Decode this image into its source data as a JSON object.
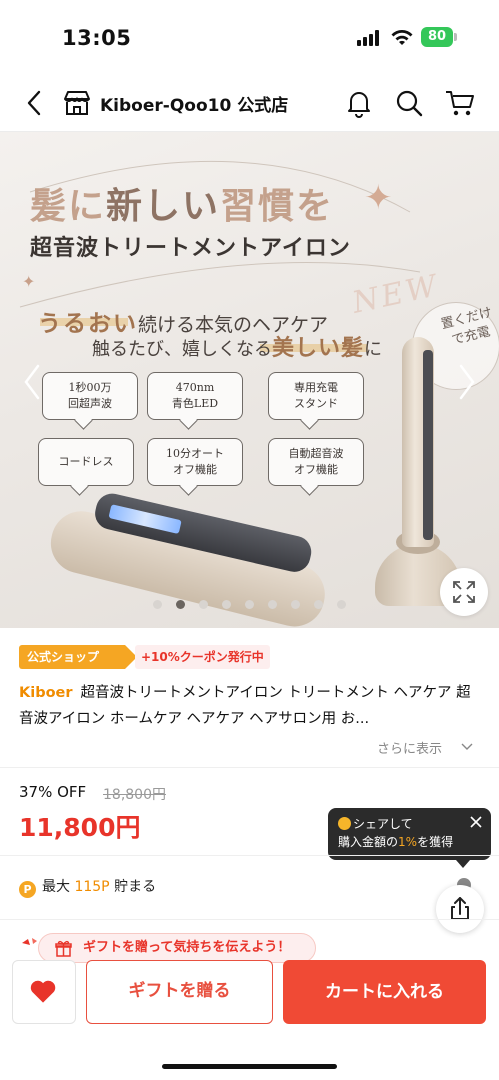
{
  "status_bar": {
    "time": "13:05",
    "battery": "80"
  },
  "header": {
    "title": "Kiboer-Qoo10 公式店"
  },
  "hero": {
    "headline_a": "髪に",
    "headline_b": "新しい",
    "headline_c": "習慣を",
    "subtitle": "超音波トリートメントアイロン",
    "tag_new": "NEW",
    "line1_hl": "うるおい",
    "line1_rest": "続ける本気のヘアケア",
    "line2_start": "触るたび、嬉しくなる",
    "line2_hl": "美しい髪",
    "line2_end": "に",
    "stamp": "置くだけで充電",
    "features": [
      {
        "l1": "1秒00万",
        "l2": "回超声波"
      },
      {
        "l1": "470nm",
        "l2": "青色LED"
      },
      {
        "l1": "専用充電",
        "l2": "スタンド"
      },
      {
        "l1": "コードレス",
        "l2": ""
      },
      {
        "l1": "10分オート",
        "l2": "オフ機能"
      },
      {
        "l1": "自動超音波",
        "l2": "オフ機能"
      }
    ],
    "carousel": {
      "total": 9,
      "active": 2
    }
  },
  "badges": {
    "official": "公式ショップ",
    "coupon": "+10%クーポン発行中"
  },
  "product": {
    "brand": "Kiboer",
    "title": "超音波トリートメントアイロン トリートメント ヘアケア 超音波アイロン ホームケア ヘアケア ヘアサロン用 お...",
    "more": "さらに表示"
  },
  "price": {
    "discount": "37% OFF",
    "original": "18,800円",
    "current": "11,800円"
  },
  "share_tip": {
    "line1": "シェアして",
    "line2_a": "購入金額の",
    "line2_pct": "1%",
    "line2_b": "を獲得"
  },
  "points": {
    "prefix": "最大",
    "amount": "115P",
    "suffix": "貯まる"
  },
  "gift_banner": "ギフトを贈って気持ちを伝えよう！",
  "actions": {
    "gift": "ギフトを贈る",
    "cart": "カートに入れる"
  },
  "colors": {
    "accent_red": "#f04a35",
    "brand_orange": "#f08c00",
    "official_badge": "#f5a623"
  },
  "icons": [
    "back-icon",
    "shop-icon",
    "bell-icon",
    "search-icon",
    "cart-icon",
    "expand-icon",
    "close-icon",
    "share-icon",
    "heart-icon",
    "gift-icon",
    "chevron-down-icon"
  ]
}
